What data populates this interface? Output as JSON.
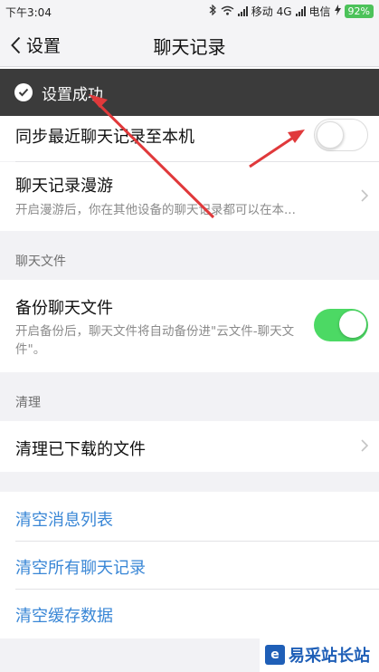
{
  "status_bar": {
    "time": "下午3:04",
    "carrier1": "移动 4G",
    "carrier2": "电信",
    "battery": "92%"
  },
  "nav": {
    "back_label": "设置",
    "title": "聊天记录"
  },
  "toast": {
    "text": "设置成功"
  },
  "rows": {
    "sync": {
      "label": "同步最近聊天记录至本机",
      "enabled": false
    },
    "roaming": {
      "label": "聊天记录漫游",
      "desc": "开启漫游后，你在其他设备的聊天记录都可以在本..."
    },
    "backup": {
      "label": "备份聊天文件",
      "desc": "开启备份后，聊天文件将自动备份进\"云文件-聊天文件\"。",
      "enabled": true
    },
    "clear_downloads": {
      "label": "清理已下载的文件"
    }
  },
  "sections": {
    "chat_files": "聊天文件",
    "cleanup": "清理"
  },
  "links": {
    "clear_messages": "清空消息列表",
    "clear_history": "清空所有聊天记录",
    "clear_cache": "清空缓存数据"
  },
  "watermark": {
    "logo": "e",
    "text": "易采站长站"
  },
  "colors": {
    "toggle_on": "#4cd964",
    "link": "#3a87d6",
    "toast_bg": "#3b3b3b",
    "arrow": "#e0393b"
  }
}
